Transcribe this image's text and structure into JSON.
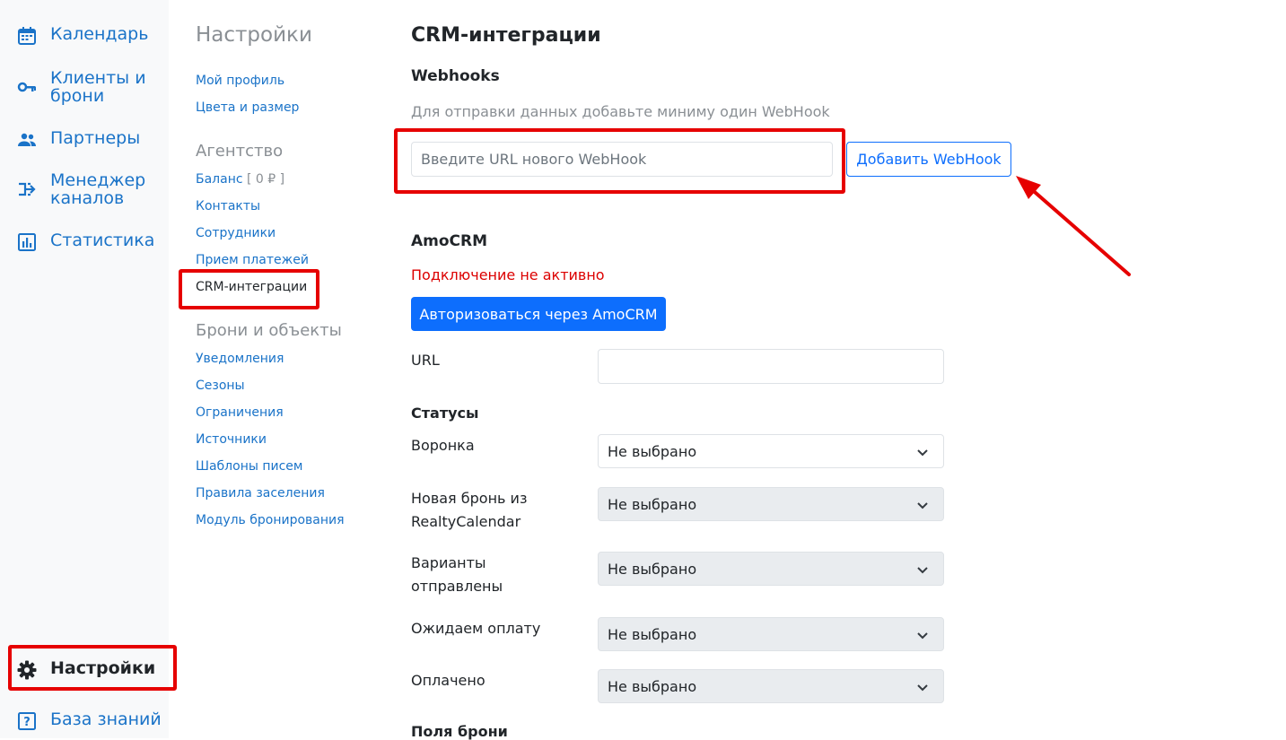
{
  "sidebar": {
    "items": [
      {
        "label": "Календарь",
        "icon": "calendar-icon"
      },
      {
        "label_line1": "Клиенты и",
        "label_line2": "брони",
        "icon": "key-icon"
      },
      {
        "label": "Партнеры",
        "icon": "people-icon"
      },
      {
        "label_line1": "Менеджер",
        "label_line2": "каналов",
        "icon": "channels-icon"
      },
      {
        "label": "Статистика",
        "icon": "bar-chart-icon"
      }
    ],
    "bottom": {
      "settings": {
        "label": "Настройки",
        "icon": "gear-icon"
      },
      "knowledge": {
        "label": "База знаний",
        "icon": "question-icon"
      }
    }
  },
  "settings_nav": {
    "title": "Настройки",
    "profile_links": [
      "Мой профиль",
      "Цвета и размер"
    ],
    "agency_title": "Агентство",
    "balance_label": "Баланс",
    "balance_value": "[ 0 ₽ ]",
    "agency_links": [
      "Контакты",
      "Сотрудники",
      "Прием платежей",
      "CRM-интеграции"
    ],
    "bookings_title": "Брони и объекты",
    "bookings_links": [
      "Уведомления",
      "Сезоны",
      "Ограничения",
      "Источники",
      "Шаблоны писем",
      "Правила заселения",
      "Модуль бронирования"
    ]
  },
  "main": {
    "title": "CRM-интеграции",
    "webhooks": {
      "title": "Webhooks",
      "hint": "Для отправки данных добавьте миниму один WebHook",
      "placeholder": "Введите URL нового WebHook",
      "add_button": "Добавить WebHook"
    },
    "amocrm": {
      "title": "AmoCRM",
      "status": "Подключение не активно",
      "auth_button": "Авторизоваться через AmoCRM",
      "url_label": "URL",
      "url_value": ""
    },
    "statuses": {
      "title": "Статусы",
      "rows": [
        {
          "line1": "Воронка",
          "line2": "",
          "value": "Не выбрано"
        },
        {
          "line1": "Новая бронь из",
          "line2": "RealtyCalendar",
          "value": "Не выбрано"
        },
        {
          "line1": "Варианты",
          "line2": "отправлены",
          "value": "Не выбрано"
        },
        {
          "line1": "Ожидаем оплату",
          "line2": "",
          "value": "Не выбрано"
        },
        {
          "line1": "Оплачено",
          "line2": "",
          "value": "Не выбрано"
        }
      ]
    },
    "booking_fields_title": "Поля брони"
  },
  "colors": {
    "accent": "#0d6efd",
    "link": "#1a73c8",
    "error": "#dc0000",
    "annotation": "#e60000"
  }
}
